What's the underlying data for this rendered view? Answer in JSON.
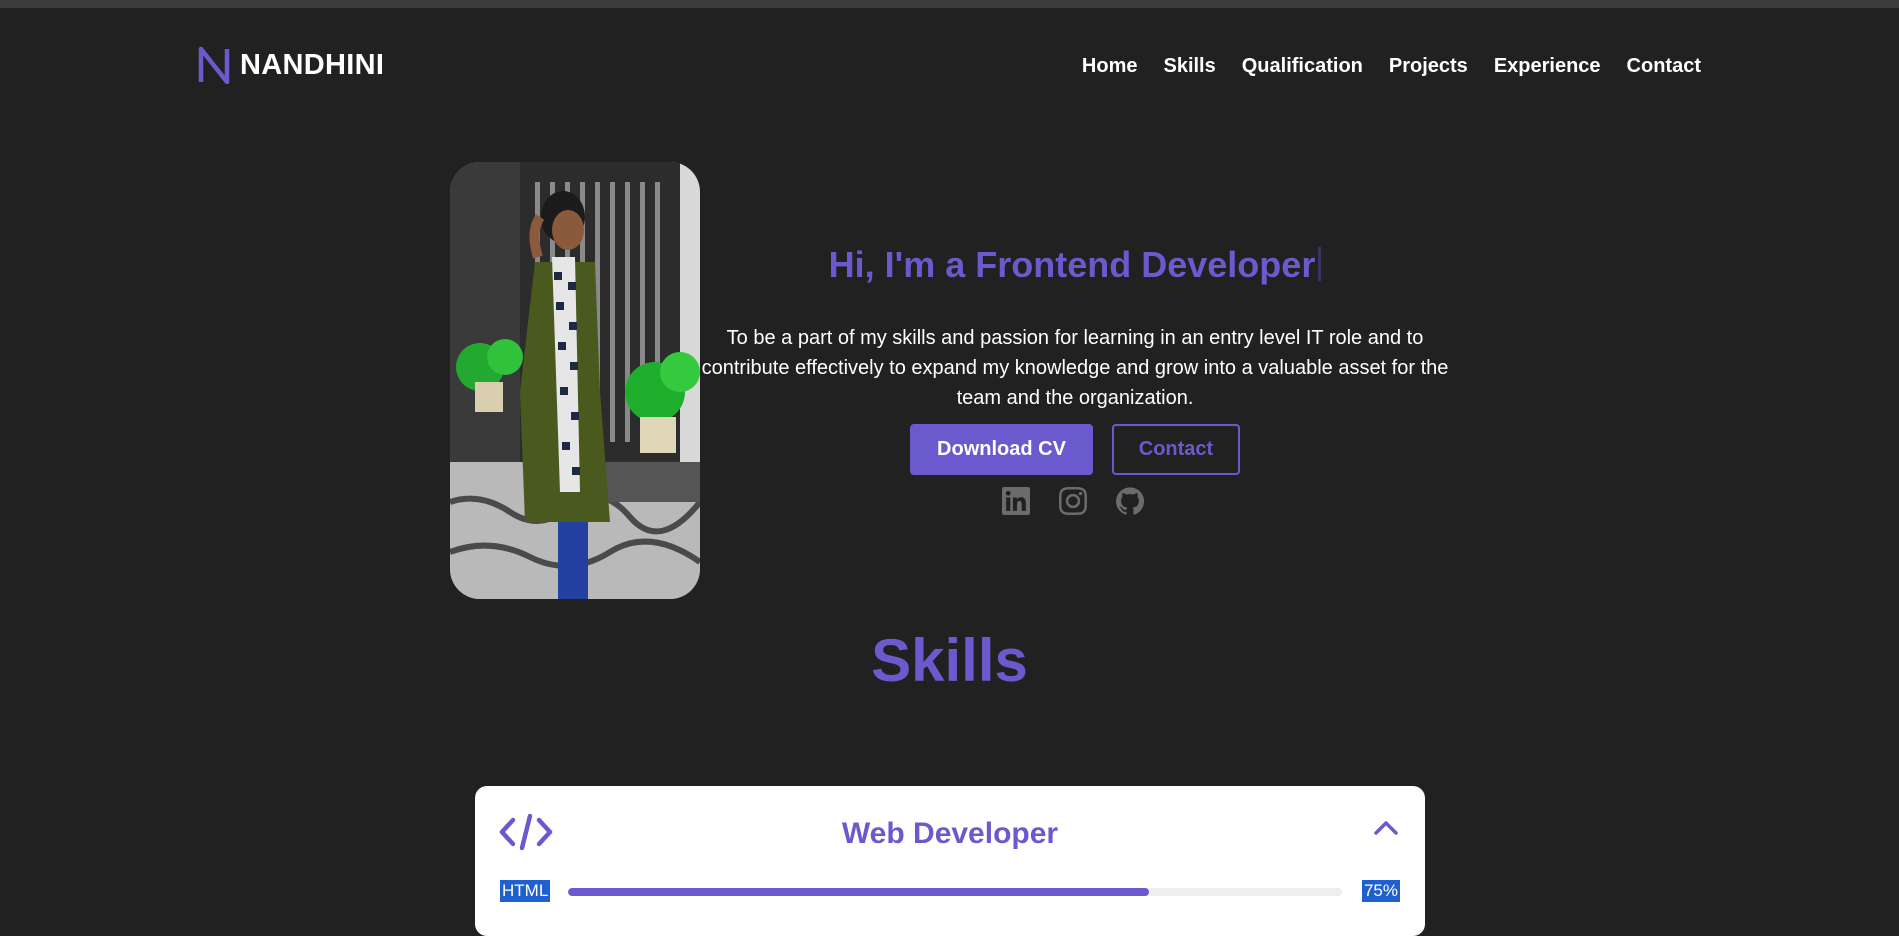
{
  "brand": {
    "logo_letter": "N",
    "name": "NANDHINI",
    "accent": "#6a5acd"
  },
  "nav": [
    {
      "label": "Home"
    },
    {
      "label": "Skills"
    },
    {
      "label": "Qualification"
    },
    {
      "label": "Projects"
    },
    {
      "label": "Experience"
    },
    {
      "label": "Contact"
    }
  ],
  "hero": {
    "title": "Hi, I'm a Frontend Developer",
    "description": "To be a part of my skills and passion for learning in an entry level IT role and to contribute effectively to expand my knowledge and grow into a valuable asset for the team and the organization.",
    "primary_button": "Download CV",
    "secondary_button": "Contact",
    "socials": [
      "linkedin-icon",
      "instagram-icon",
      "github-icon"
    ]
  },
  "skills": {
    "title": "Skills",
    "card": {
      "title": "Web Developer",
      "icon": "code-icon",
      "items": [
        {
          "name": "HTML",
          "percent_label": "75%",
          "percent": 75
        }
      ]
    }
  }
}
